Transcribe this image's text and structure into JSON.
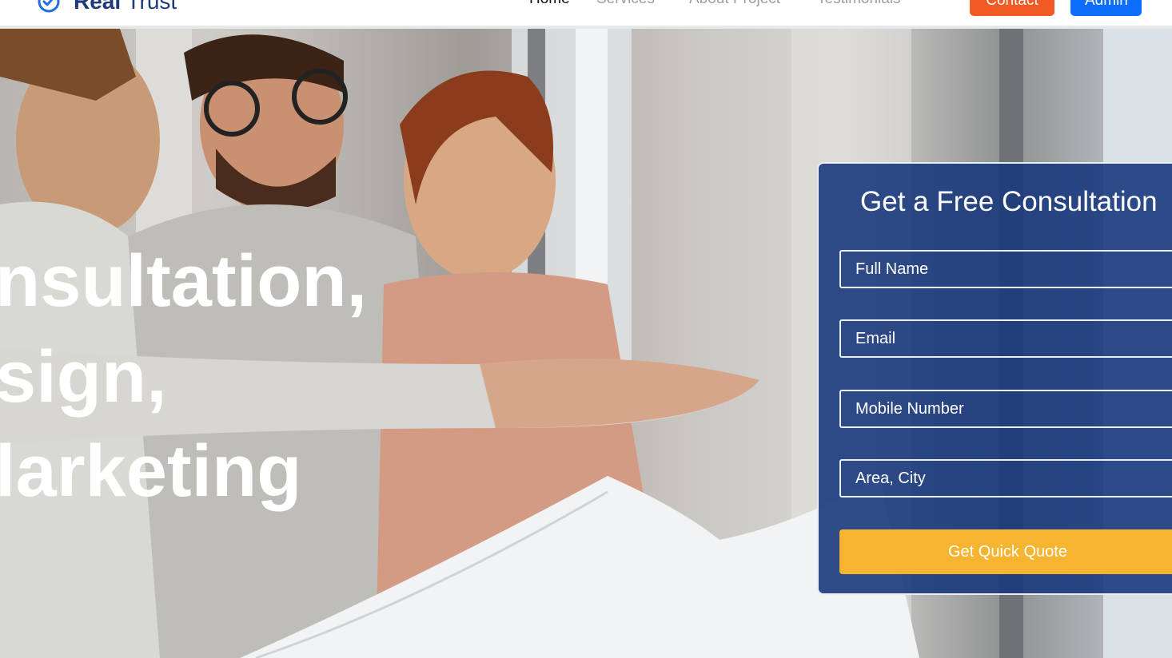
{
  "header": {
    "logo_text_bold": "Real",
    "logo_text_light": " Trust",
    "logo_icon": "check-circle-icon",
    "nav": [
      "Home",
      "Services",
      "About Project",
      "Testimonials"
    ],
    "contact_label": "Contact",
    "admin_label": "Admin",
    "colors": {
      "contact": "#f15a24",
      "admin": "#0d6efd",
      "brand": "#1f3a7a"
    }
  },
  "hero": {
    "lines": [
      "nsultation,",
      "sign,",
      "larketing"
    ]
  },
  "form": {
    "title": "Get a Free Consultation",
    "fields": {
      "full_name": "Full Name",
      "email": "Email",
      "mobile": "Mobile Number",
      "area": "Area, City"
    },
    "submit_label": "Get Quick Quote",
    "colors": {
      "card": "#193a7d",
      "button": "#f6b431"
    }
  }
}
